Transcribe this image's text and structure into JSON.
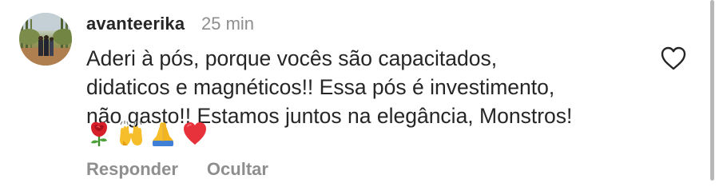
{
  "comment": {
    "username": "avanteerika",
    "timestamp": "25 min",
    "text_lines": [
      "Aderi à pós, porque vocês são capacitados,",
      "didaticos e magnéticos!! Essa pós é investimento,",
      "não gasto!! Estamos juntos na elegância, Monstros!"
    ],
    "emojis": [
      "rose-emoji",
      "raising-hands-emoji",
      "folded-hands-emoji",
      "red-heart-emoji"
    ],
    "actions": {
      "reply_label": "Responder",
      "hide_label": "Ocultar"
    },
    "like_icon": "heart-outline-icon"
  },
  "colors": {
    "text": "#262626",
    "secondary_text": "#8e8e8e",
    "heart": "#e8323b"
  }
}
